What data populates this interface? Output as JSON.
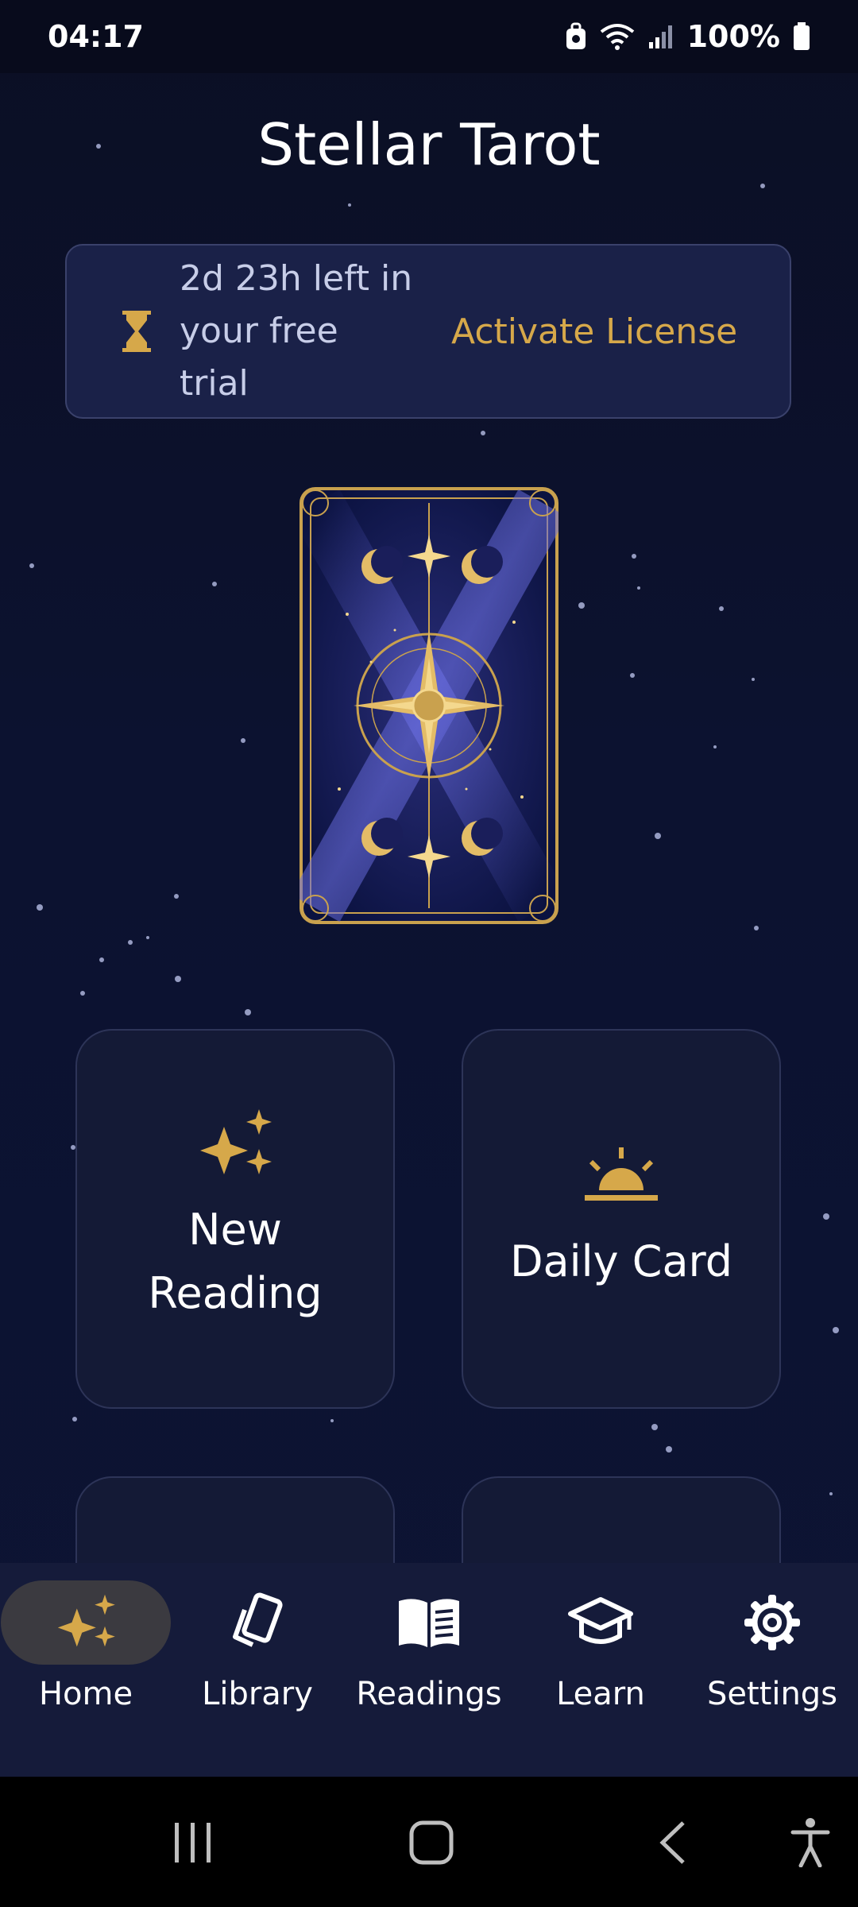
{
  "status_bar": {
    "time": "04:17",
    "battery": "100%"
  },
  "app": {
    "title": "Stellar Tarot"
  },
  "trial_banner": {
    "line1": "2d 23h left in",
    "line2": "your free trial",
    "action_label": "Activate License"
  },
  "tiles": {
    "new_reading_line1": "New",
    "new_reading_line2": "Reading",
    "daily_card": "Daily Card"
  },
  "bottom_nav": {
    "items": [
      {
        "label": "Home",
        "icon": "sparkles-icon",
        "active": true
      },
      {
        "label": "Library",
        "icon": "cards-icon",
        "active": false
      },
      {
        "label": "Readings",
        "icon": "book-icon",
        "active": false
      },
      {
        "label": "Learn",
        "icon": "graduation-cap-icon",
        "active": false
      },
      {
        "label": "Settings",
        "icon": "gear-icon",
        "active": false
      }
    ]
  },
  "colors": {
    "accent": "#d6a84a",
    "background": "#0b0f24",
    "panel": "#141a36"
  }
}
